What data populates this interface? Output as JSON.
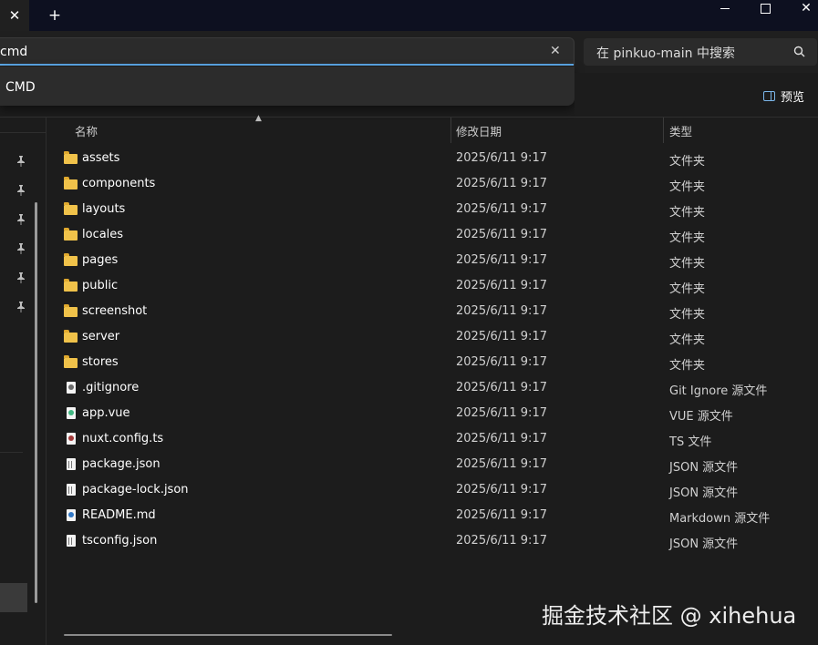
{
  "titlebar": {
    "new_tab_label": "+"
  },
  "address": {
    "value": "cmd",
    "suggestion": "CMD"
  },
  "search": {
    "placeholder": "在 pinkuo-main 中搜索"
  },
  "toolbar": {
    "preview_label": "预览"
  },
  "columns": {
    "name": "名称",
    "date": "修改日期",
    "type": "类型"
  },
  "files": [
    {
      "name": "assets",
      "date": "2025/6/11 9:17",
      "type": "文件夹",
      "icon": "folder-icon"
    },
    {
      "name": "components",
      "date": "2025/6/11 9:17",
      "type": "文件夹",
      "icon": "folder-icon"
    },
    {
      "name": "layouts",
      "date": "2025/6/11 9:17",
      "type": "文件夹",
      "icon": "folder-icon"
    },
    {
      "name": "locales",
      "date": "2025/6/11 9:17",
      "type": "文件夹",
      "icon": "folder-icon"
    },
    {
      "name": "pages",
      "date": "2025/6/11 9:17",
      "type": "文件夹",
      "icon": "folder-icon"
    },
    {
      "name": "public",
      "date": "2025/6/11 9:17",
      "type": "文件夹",
      "icon": "folder-icon"
    },
    {
      "name": "screenshot",
      "date": "2025/6/11 9:17",
      "type": "文件夹",
      "icon": "folder-icon"
    },
    {
      "name": "server",
      "date": "2025/6/11 9:17",
      "type": "文件夹",
      "icon": "folder-icon"
    },
    {
      "name": "stores",
      "date": "2025/6/11 9:17",
      "type": "文件夹",
      "icon": "folder-icon"
    },
    {
      "name": ".gitignore",
      "date": "2025/6/11 9:17",
      "type": "Git Ignore 源文件",
      "icon": "gitignore-file-icon"
    },
    {
      "name": "app.vue",
      "date": "2025/6/11 9:17",
      "type": "VUE 源文件",
      "icon": "vue-file-icon"
    },
    {
      "name": "nuxt.config.ts",
      "date": "2025/6/11 9:17",
      "type": "TS 文件",
      "icon": "ts-file-icon"
    },
    {
      "name": "package.json",
      "date": "2025/6/11 9:17",
      "type": "JSON 源文件",
      "icon": "json-file-icon"
    },
    {
      "name": "package-lock.json",
      "date": "2025/6/11 9:17",
      "type": "JSON 源文件",
      "icon": "json-file-icon"
    },
    {
      "name": "README.md",
      "date": "2025/6/11 9:17",
      "type": "Markdown 源文件",
      "icon": "markdown-file-icon"
    },
    {
      "name": "tsconfig.json",
      "date": "2025/6/11 9:17",
      "type": "JSON 源文件",
      "icon": "json-file-icon"
    }
  ],
  "watermark": "掘金技术社区 @ xihehua",
  "colors": {
    "accent": "#5da9e9",
    "folder": "#f0c24a",
    "background": "#1c1c1c"
  }
}
